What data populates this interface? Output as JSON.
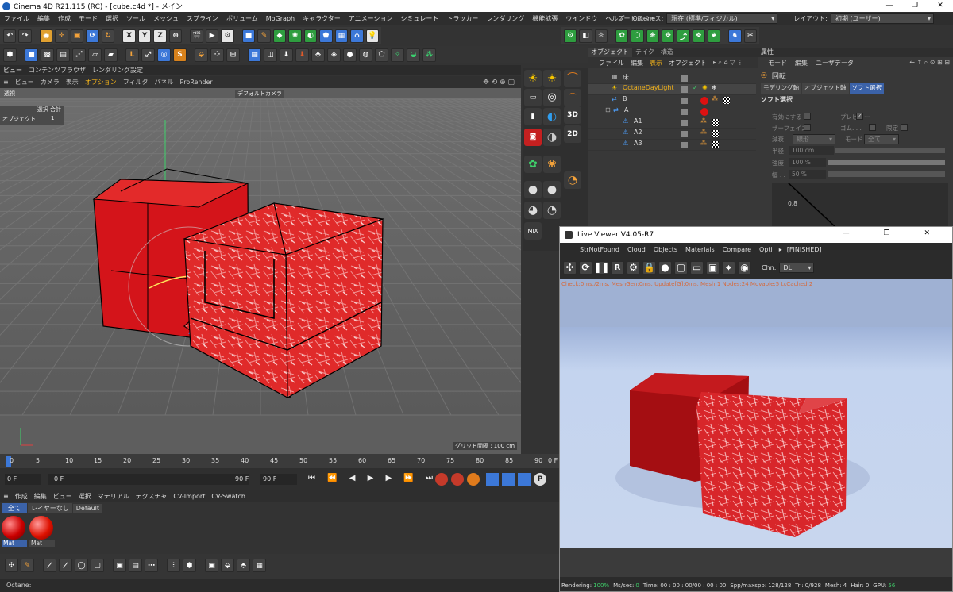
{
  "window": {
    "title": "Cinema 4D R21.115 (RC) - [cube.c4d *] - メイン"
  },
  "menubar": {
    "items": [
      "ファイル",
      "編集",
      "作成",
      "モード",
      "選択",
      "ツール",
      "メッシュ",
      "スプライン",
      "ボリューム",
      "MoGraph",
      "キャラクター",
      "アニメーション",
      "シミュレート",
      "トラッカー",
      "レンダリング",
      "機能拡張",
      "ウインドウ",
      "ヘルプ",
      "Octane"
    ],
    "nodespace_label": "ノードスペース:",
    "nodespace_value": "現在 (標準/フィジカル)",
    "layout_label": "レイアウト:",
    "layout_value": "初期 (ユーザー)"
  },
  "toolbar1": {
    "axes": [
      "X",
      "Y",
      "Z"
    ]
  },
  "viewport": {
    "tabs": [
      "ビュー",
      "コンテンツブラウザ",
      "レンダリング設定"
    ],
    "menu": [
      "ビュー",
      "カメラ",
      "表示",
      "オプション",
      "フィルタ",
      "パネル",
      "ProRender"
    ],
    "active_menu": "オプション",
    "projection": "透視",
    "camera": "デフォルトカメラ",
    "info_header": "選択  合計",
    "info_row_label": "オブジェクト",
    "info_row_value": "1",
    "grid": "グリッド間隔 : 100 cm"
  },
  "left_icons": {
    "label_3d": "3D",
    "label_2d": "2D",
    "label_mix": "MIX"
  },
  "objects": {
    "tabs": [
      "オブジェクト",
      "テイク",
      "構造"
    ],
    "menu": [
      "ファイル",
      "編集",
      "表示",
      "オブジェクト"
    ],
    "rows": [
      {
        "name": "床",
        "indent": 0
      },
      {
        "name": "OctaneDayLight",
        "indent": 0,
        "highlight": true
      },
      {
        "name": "B",
        "indent": 0
      },
      {
        "name": "A",
        "indent": 0
      },
      {
        "name": "A1",
        "indent": 1
      },
      {
        "name": "A2",
        "indent": 1
      },
      {
        "name": "A3",
        "indent": 1
      }
    ]
  },
  "attributes": {
    "title": "属性",
    "menu": [
      "モード",
      "編集",
      "ユーザデータ"
    ],
    "object": "回転",
    "tabs": [
      "モデリング軸",
      "オブジェクト軸",
      "ソフト選択"
    ],
    "active_tab": "ソフト選択",
    "section": "ソフト選択",
    "enable_label": "有効にする",
    "preview_label": "プレビュー",
    "surface_label": "サーフェイス",
    "rubber_label": "ゴム. . .",
    "limit_label": "限定",
    "falloff_label": "減衰",
    "falloff_value": "線形",
    "mode_label": "モード",
    "mode_value": "全て",
    "radius_label": "半径",
    "radius_value": "100 cm",
    "strength_label": "強度",
    "strength_value": "100 %",
    "width_label": "幅 . .",
    "width_value": "50 %",
    "graph_value": "0.8"
  },
  "liveviewer": {
    "title": "Live Viewer V4.05-R7",
    "menu": [
      "StrNotFound",
      "Cloud",
      "Objects",
      "Materials",
      "Compare",
      "Opti"
    ],
    "status": "[FINISHED]",
    "chn_label": "Chn:",
    "chn_value": "DL",
    "info": "Check:0ms./2ms. MeshGen:0ms. Update[G]:0ms. Mesh:1 Nodes:24 Movable:5 txCached:2",
    "stats": [
      [
        "Rendering:",
        "100%"
      ],
      [
        "Ms/sec:",
        "0"
      ],
      [
        "Time:",
        "00 : 00 : 00/00 : 00 : 00"
      ],
      [
        "Spp/maxspp:",
        "128/128"
      ],
      [
        "Tri:",
        "0/928"
      ],
      [
        "Mesh:",
        "4"
      ],
      [
        "Hair:",
        "0"
      ],
      [
        "GPU:",
        "56"
      ]
    ]
  },
  "timeline": {
    "ticks": [
      "0",
      "5",
      "10",
      "15",
      "20",
      "25",
      "30",
      "35",
      "40",
      "45",
      "50",
      "55",
      "60",
      "65",
      "70",
      "75",
      "80",
      "85",
      "90"
    ],
    "end_label": "0 F",
    "current": "0 F",
    "start": "0 F",
    "end": "90 F",
    "end2": "90 F"
  },
  "materials": {
    "menu": [
      "作成",
      "編集",
      "ビュー",
      "選択",
      "マテリアル",
      "テクスチャ",
      "CV-Import",
      "CV-Swatch"
    ],
    "filters": [
      "全て",
      "レイヤーなし",
      "Default"
    ],
    "items": [
      "Mat",
      "Mat"
    ]
  },
  "status": {
    "text": "Octane:"
  }
}
